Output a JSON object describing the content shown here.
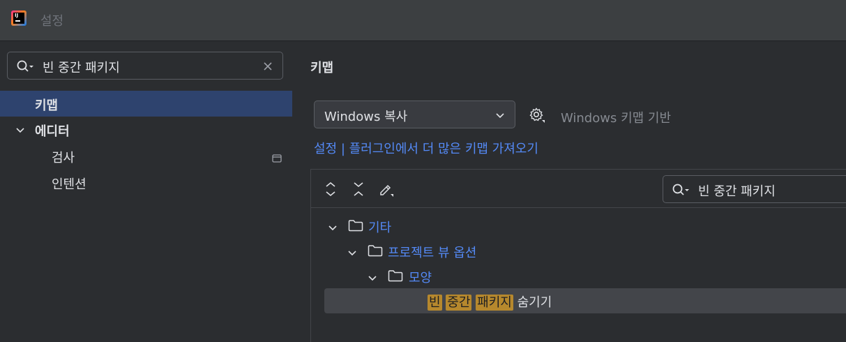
{
  "window": {
    "title": "설정"
  },
  "left": {
    "search_query": "빈 중간 패키지",
    "tree": [
      {
        "label": "키맵"
      },
      {
        "label": "에디터"
      },
      {
        "label": "검사"
      },
      {
        "label": "인텐션"
      }
    ]
  },
  "right": {
    "section_title": "키맵",
    "keymap_value": "Windows 복사",
    "based_on": "Windows 키맵 기반",
    "plugins_link": "설정 | 플러그인에서 더 많은 키맵 가져오기",
    "filter_query": "빈 중간 패키지",
    "actions": [
      {
        "label": "기타"
      },
      {
        "label": "프로젝트 뷰 옵션"
      },
      {
        "label": "모양"
      }
    ],
    "result_row": {
      "highlight_1": "빈",
      "highlight_2": "중간",
      "highlight_3": "패키지",
      "rest": "숨기기"
    }
  },
  "icons": [
    "app-logo-icon",
    "search-icon",
    "clear-icon",
    "chevron-down-icon",
    "window-icon",
    "gear-icon",
    "expand-all-icon",
    "collapse-all-icon",
    "edit-icon",
    "folder-icon"
  ],
  "colors": {
    "accent": "#548af7",
    "selection": "#2e436e",
    "highlight": "#b6882d"
  }
}
